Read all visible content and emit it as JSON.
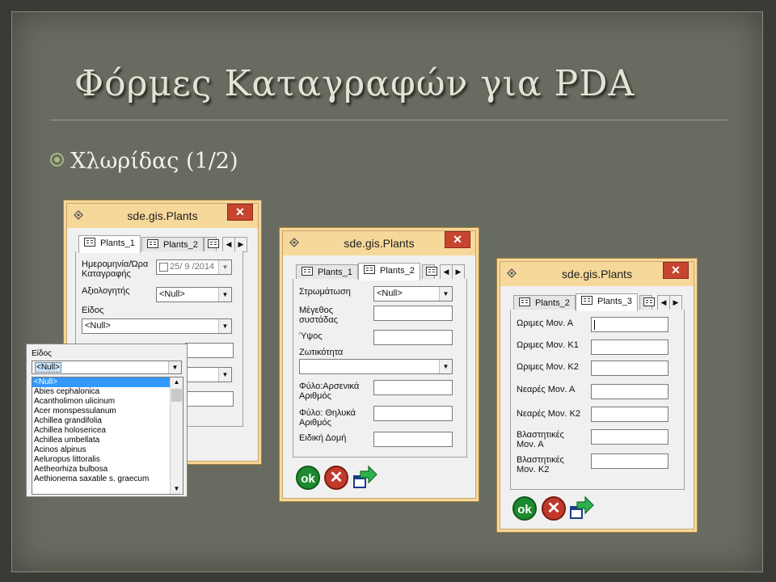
{
  "slide": {
    "title": "Φόρμες Καταγραφών για PDA",
    "bullet": "Χλωρίδας (1/2)"
  },
  "window1": {
    "title": "sde.gis.Plants",
    "close": "✕",
    "tabs": [
      "Plants_1",
      "Plants_2"
    ],
    "labels": {
      "date": "Ημερομηνία/Ώρα Καταγραφής",
      "assessor": "Αξιολογητής",
      "species": "Είδος"
    },
    "date_value": "25/ 9 /2014",
    "assessor_value": "<Null>",
    "species_value": "<Null>"
  },
  "species_dropdown": {
    "label": "Είδος",
    "value": "<Null>",
    "options": [
      "<Null>",
      "Abies cephalonica",
      "Acantholimon ulicinum",
      "Acer monspessulanum",
      "Achillea grandifolia",
      "Achillea holosericea",
      "Achillea umbellata",
      "Acinos alpinus",
      "Aeluropus littoralis",
      "Aetheorhiza bulbosa",
      "Aethionema saxatile s. graecum"
    ]
  },
  "window2": {
    "title": "sde.gis.Plants",
    "close": "✕",
    "tabs": [
      "Plants_1",
      "Plants_2"
    ],
    "labels": {
      "stratification": "Στρωμάτωση",
      "cluster_size": "Μέγεθος συστάδας",
      "height": "Ύψος",
      "vitality": "Ζωτικότητα",
      "male_count": "Φύλο:Αρσενικά Αριθμός",
      "female_count": "Φύλο: Θηλυκά Αριθμός",
      "special_structure": "Ειδική Δομή"
    },
    "stratification_value": "<Null>",
    "ok": "ok",
    "cancel": "✕"
  },
  "window3": {
    "title": "sde.gis.Plants",
    "close": "✕",
    "tabs": [
      "Plants_2",
      "Plants_3"
    ],
    "labels": {
      "mature_a": "Ωριμες Μον. Α",
      "mature_k1": "Ωριμες Μον. Κ1",
      "mature_k2": "Ωριμες Μον. Κ2",
      "young_a": "Νεαρές Μον. Α",
      "young_k2": "Νεαρές Μον. Κ2",
      "veg_a": "Βλαστητικές Μον. Α",
      "veg_k2": "Βλαστητικές Μον. Κ2"
    },
    "ok": "ok",
    "cancel": "✕"
  },
  "colors": {
    "slide_bg": "#686b5f",
    "titlebar": "#f6d89a",
    "close_red": "#c7452f",
    "ok_green": "#1c8a2e",
    "cancel_red": "#c0392b",
    "list_selection": "#3399ff"
  },
  "icons": [
    "bullet-circle-icon",
    "app-diamond-icon",
    "close-icon",
    "tab-form-icon",
    "scroll-left-icon",
    "scroll-right-icon",
    "dropdown-arrow-icon",
    "ok-icon",
    "cancel-icon",
    "next-arrow-icon"
  ]
}
